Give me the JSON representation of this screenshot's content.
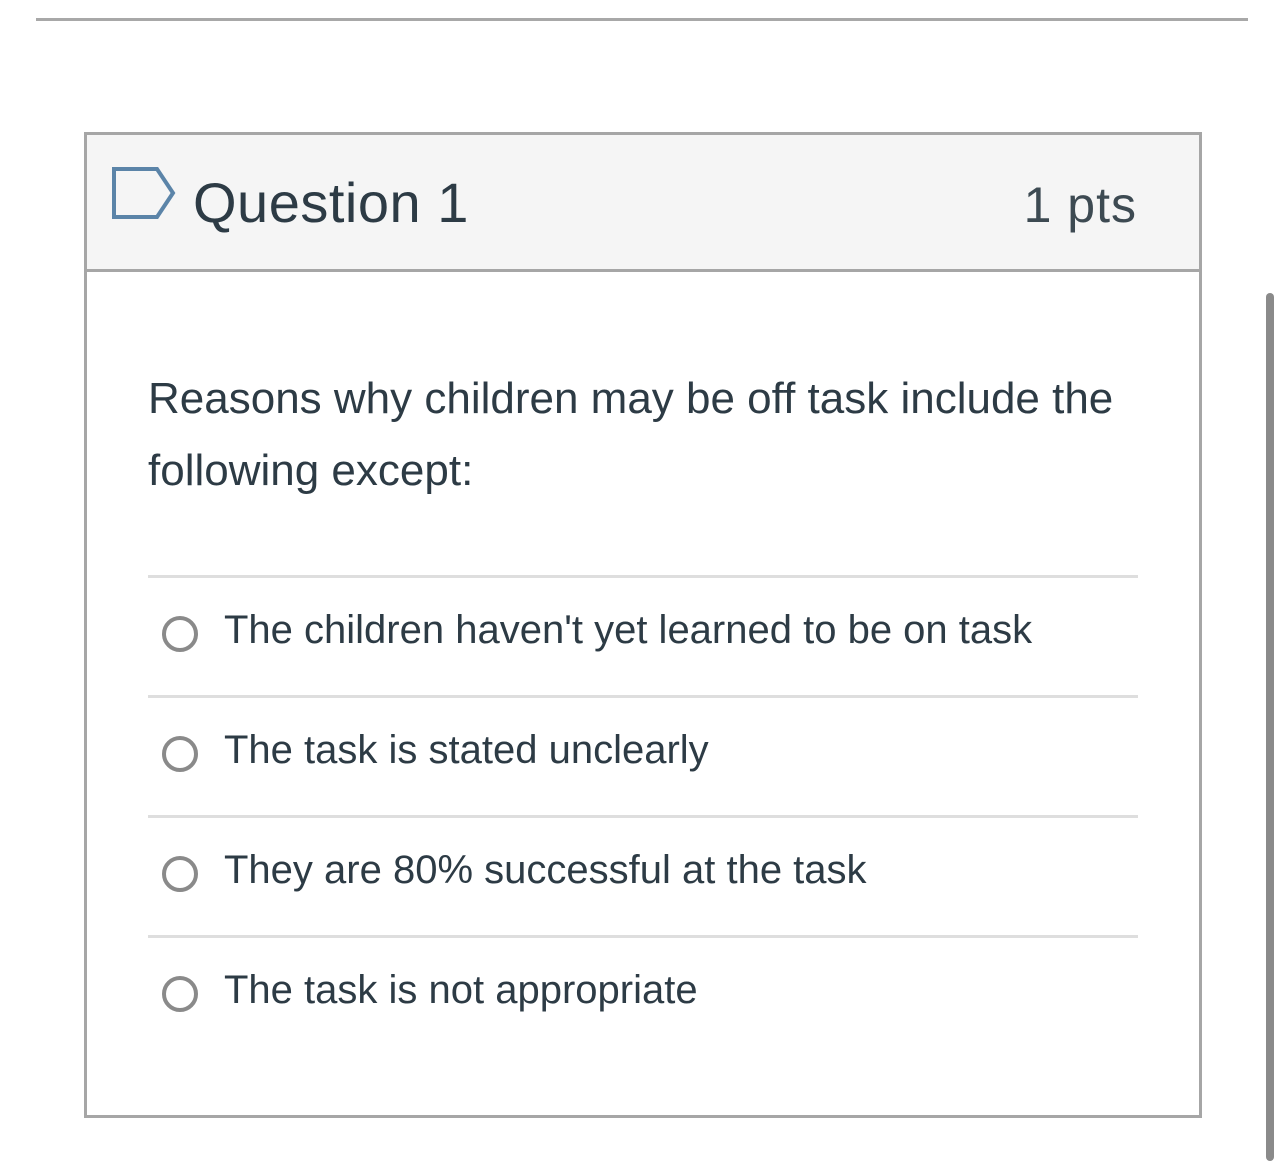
{
  "question": {
    "title": "Question 1",
    "points": "1 pts",
    "flag_icon": "flag-outline-icon",
    "text": "Reasons why children may be off task include the following except:",
    "answers": [
      {
        "label": "The children haven't yet learned to be on task",
        "selected": false
      },
      {
        "label": "The task is stated unclearly",
        "selected": false
      },
      {
        "label": "They are 80% successful at the task",
        "selected": false
      },
      {
        "label": "The task is not appropriate",
        "selected": false
      }
    ]
  },
  "colors": {
    "header_bg": "#f5f5f5",
    "border": "#a6a6a6",
    "text": "#2d3b45",
    "flag_stroke": "#5b84a8"
  }
}
